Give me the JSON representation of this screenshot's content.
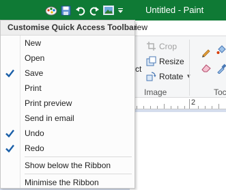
{
  "window": {
    "title": "Untitled - Paint"
  },
  "ribbon": {
    "tab_partial_label": "iew",
    "crop_label": "Crop",
    "resize_label": "Resize",
    "rotate_label": "Rotate",
    "image_group_label": "Image",
    "tools_group_partial_label": "Toc",
    "select_partial_label": "ct"
  },
  "ruler": {
    "mark_label": "2"
  },
  "menu": {
    "title": "Customise Quick Access Toolbar",
    "items": [
      {
        "label": "New",
        "checked": false
      },
      {
        "label": "Open",
        "checked": false
      },
      {
        "label": "Save",
        "checked": true
      },
      {
        "label": "Print",
        "checked": false
      },
      {
        "label": "Print preview",
        "checked": false
      },
      {
        "label": "Send in email",
        "checked": false
      },
      {
        "label": "Undo",
        "checked": true
      },
      {
        "label": "Redo",
        "checked": true
      }
    ],
    "extra_items": [
      {
        "label": "Show below the Ribbon"
      },
      {
        "label": "Minimise the Ribbon"
      }
    ]
  },
  "colors": {
    "titlebar": "#0f7a35",
    "check": "#1a5fa8",
    "canvas_background": "#d5dded"
  }
}
